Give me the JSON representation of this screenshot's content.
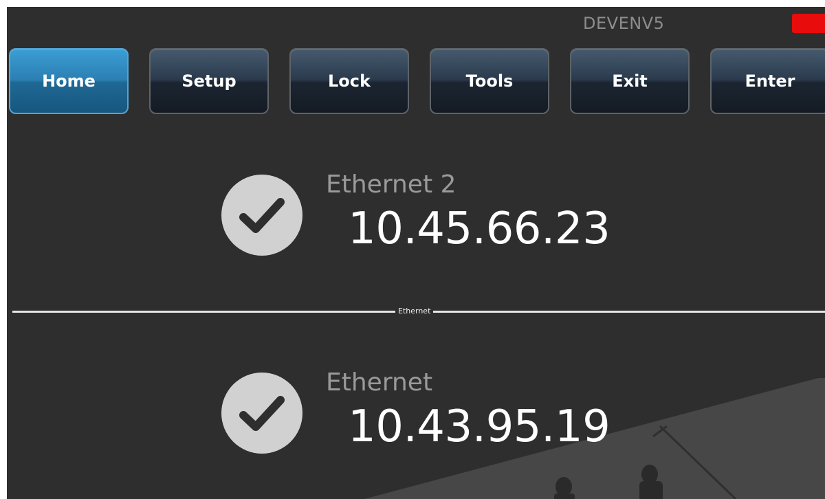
{
  "device": {
    "name": "DEVENV5",
    "status_color": "#e80c0c"
  },
  "toolbar": {
    "buttons": [
      {
        "label": "Home",
        "active": true
      },
      {
        "label": "Setup",
        "active": false
      },
      {
        "label": "Lock",
        "active": false
      },
      {
        "label": "Tools",
        "active": false
      },
      {
        "label": "Exit",
        "active": false
      },
      {
        "label": "Enter",
        "active": false
      }
    ]
  },
  "networks": [
    {
      "adapter": "Ethernet 2",
      "ip": "10.45.66.23",
      "status_icon": "check-icon"
    },
    {
      "adapter": "Ethernet",
      "ip": "10.43.95.19",
      "status_icon": "check-icon"
    }
  ],
  "divider": {
    "label": "Ethernet"
  },
  "colors": {
    "background": "#2e2e2e",
    "active_button": "#2c7fb3",
    "button": "#2a3a4c",
    "icon_circle": "#d1d1d1"
  }
}
